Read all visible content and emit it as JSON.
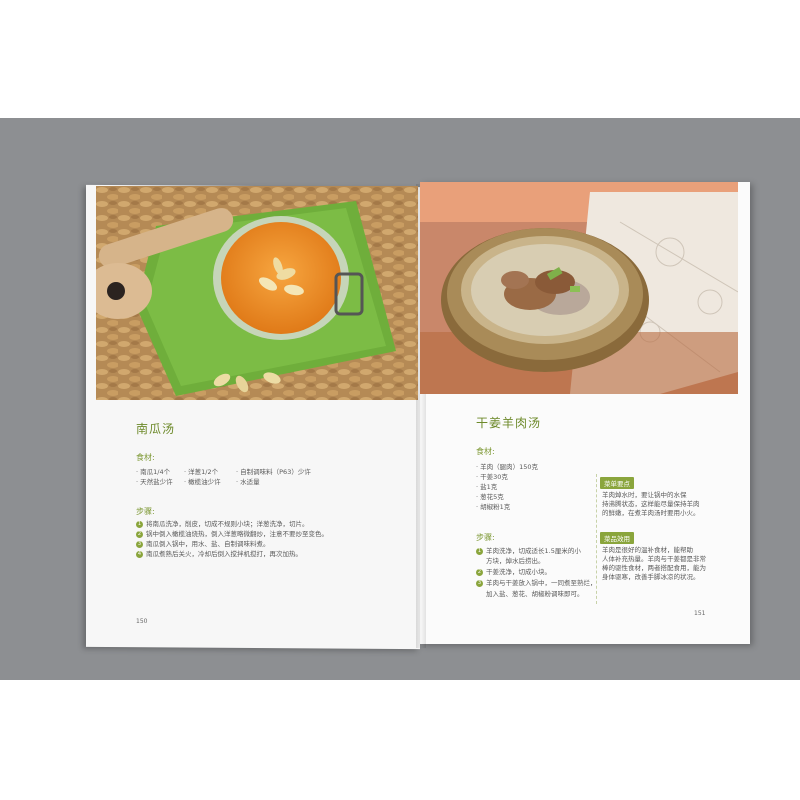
{
  "left_page": {
    "title": "南瓜汤",
    "ingredients_label": "食材:",
    "ingredients": [
      "· 南瓜1/4个",
      "· 洋葱1/2个",
      "· 自制调味料（P63）少许",
      "· 天然盐少许",
      "· 橄榄油少许",
      "· 水适量"
    ],
    "steps_label": "步骤:",
    "steps": [
      {
        "n": "1",
        "text": "将南瓜洗净，削皮，切成不规则小块；洋葱洗净，切片。"
      },
      {
        "n": "2",
        "text": "锅中倒入橄榄油烧热，倒入洋葱略微翻炒，注意不要炒至变色。"
      },
      {
        "n": "3",
        "text": "南瓜倒入锅中，用水、盐、自制调味料煮。"
      },
      {
        "n": "4",
        "text": "南瓜煮熟后关火，冷却后倒入搅拌机搅打，再次加热。"
      }
    ],
    "page_number": "150"
  },
  "right_page": {
    "title": "干姜羊肉汤",
    "ingredients_label": "食材:",
    "ingredients": [
      "· 羊肉（腿肉）150克",
      "· 干姜30克",
      "· 盐1克",
      "· 葱花5克",
      "· 胡椒粉1克"
    ],
    "steps_label": "步骤:",
    "steps": [
      {
        "n": "1",
        "text": "羊肉洗净，切成适长1.5厘米的小"
      },
      {
        "n": "",
        "text": "方块，焯水后捞出。"
      },
      {
        "n": "2",
        "text": "干姜洗净，切成小块。"
      },
      {
        "n": "3",
        "text": "羊肉与干姜放入锅中，一同煮至熟烂，"
      },
      {
        "n": "",
        "text": "加入盐、葱花、胡椒粉调味即可。"
      }
    ],
    "tip_label": "菜单要点",
    "tip_text": [
      "羊肉焯水时，要让锅中的水保",
      "持沸腾状态，这样能尽量保持羊肉",
      "的鲜嫩，在煮羊肉汤时要用小火。"
    ],
    "effect_label": "菜品效用",
    "effect_text": [
      "羊肉是很好的温补食材，能帮助",
      "人体补充热量。羊肉与干姜都是非常",
      "棒的驱性食材，两者搭配食用，能为",
      "身体驱寒，改善手脚冰凉的状况。"
    ],
    "page_number": "151"
  },
  "colors": {
    "accent": "#8aa53c",
    "backdrop": "#8d8f92",
    "soup_orange": "#e98a24"
  }
}
